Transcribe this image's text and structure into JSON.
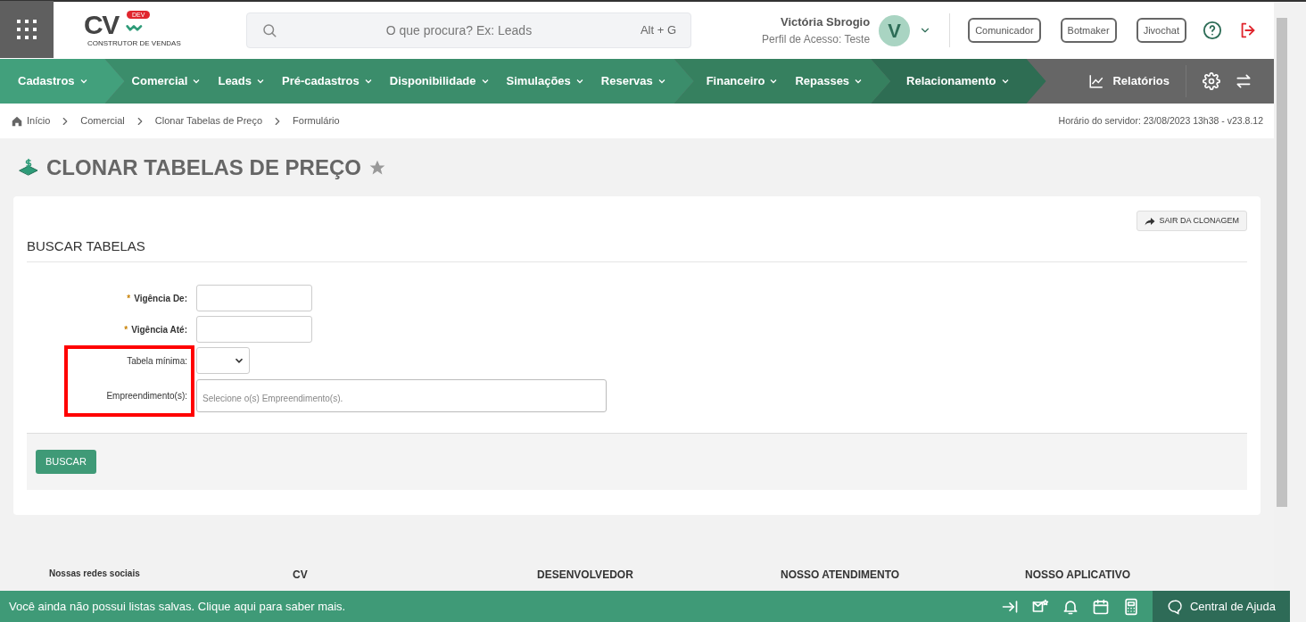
{
  "header": {
    "logo": {
      "text": "CV",
      "badge": "DEV",
      "tagline": "CONSTRUTOR DE VENDAS"
    },
    "search": {
      "placeholder": "O que procura? Ex: Leads",
      "shortcut": "Alt + G"
    },
    "user": {
      "name": "Victória Sbrogio",
      "profile": "Perfil de Acesso: Teste",
      "avatar": "V"
    },
    "buttons": [
      "Comunicador",
      "Botmaker",
      "Jivochat"
    ]
  },
  "nav": {
    "groups": [
      {
        "color": "#42a07c",
        "items": [
          "Cadastros"
        ]
      },
      {
        "color": "#3b8d6b",
        "items": [
          "Comercial",
          "Leads",
          "Pré-cadastros",
          "Disponibilidade",
          "Simulações",
          "Reservas"
        ]
      },
      {
        "color": "#36805f",
        "items": [
          "Financeiro",
          "Repasses"
        ]
      },
      {
        "color": "#2e6d53",
        "items": [
          "Relacionamento"
        ]
      }
    ],
    "reports": "Relatórios"
  },
  "breadcrumb": [
    "Início",
    "Comercial",
    "Clonar Tabelas de Preço",
    "Formulário"
  ],
  "server_time": "Horário do servidor: 23/08/2023 13h38 - v23.8.12",
  "page_title": "CLONAR TABELAS DE PREÇO",
  "exit_button": "SAIR DA CLONAGEM",
  "section_title": "BUSCAR TABELAS",
  "required_marker": "*",
  "fields": [
    {
      "kind": "text",
      "label": "Vigência De:",
      "required": true,
      "highlighted": false
    },
    {
      "kind": "text",
      "label": "Vigência Até:",
      "required": true,
      "highlighted": false
    },
    {
      "kind": "select",
      "label": "Tabela mínima:",
      "required": false,
      "highlighted": true
    },
    {
      "kind": "multiselect",
      "label": "Empreendimento(s):",
      "required": false,
      "highlighted": true,
      "placeholder": "Selecione o(s) Empreendimento(s)."
    }
  ],
  "search_button": "BUSCAR",
  "footer": {
    "headings": [
      "Nossas redes sociais",
      "CV",
      "DESENVOLVEDOR",
      "NOSSO ATENDIMENTO",
      "NOSSO APLICATIVO"
    ]
  },
  "bottom_bar": {
    "message": "Você ainda não possui listas salvas. Clique aqui para saber mais.",
    "help": "Central de Ajuda"
  }
}
